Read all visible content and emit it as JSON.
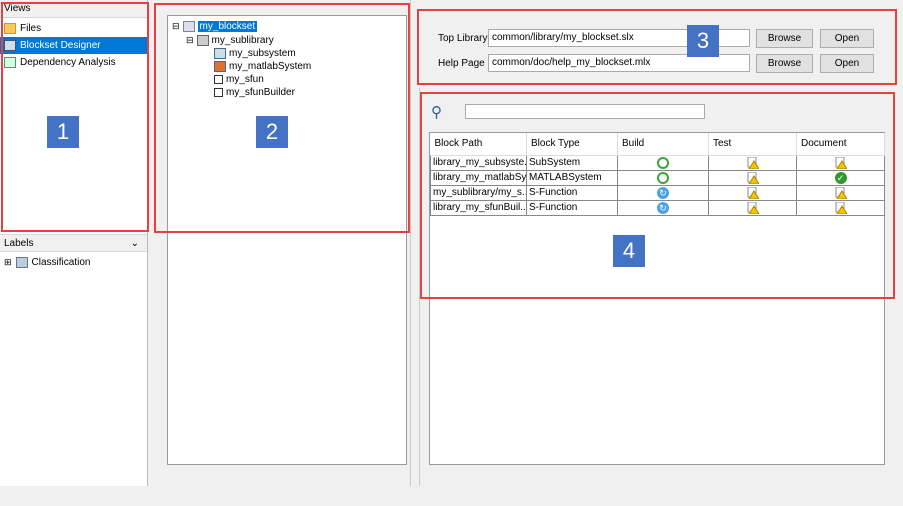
{
  "views": {
    "header": "Views",
    "items": [
      {
        "label": "Files",
        "icon": "folder-icon"
      },
      {
        "label": "Blockset Designer",
        "icon": "blockset-icon",
        "selected": true
      },
      {
        "label": "Dependency Analysis",
        "icon": "dependency-icon"
      }
    ]
  },
  "labels": {
    "header": "Labels",
    "items": [
      {
        "label": "Classification"
      }
    ]
  },
  "tree": {
    "root": "my_blockset",
    "sublibrary": "my_sublibrary",
    "children": [
      "my_subsystem",
      "my_matlabSystem",
      "my_sfun",
      "my_sfunBuilder"
    ]
  },
  "settings": {
    "top_library_label": "Top Library",
    "top_library_value": "common/library/my_blockset.slx",
    "help_page_label": "Help Page",
    "help_page_value": "common/doc/help_my_blockset.mlx",
    "browse_label": "Browse",
    "open_label": "Open"
  },
  "search": {
    "value": ""
  },
  "table": {
    "columns": [
      "Block Path",
      "Block Type",
      "Build",
      "Test",
      "Document"
    ],
    "rows": [
      {
        "path": "library_my_subsyste...",
        "type": "SubSystem",
        "build": "not-built",
        "test": "warning",
        "doc": "warning"
      },
      {
        "path": "library_my_matlabSy...",
        "type": "MATLABSystem",
        "build": "not-built",
        "test": "warning",
        "doc": "ok"
      },
      {
        "path": "my_sublibrary/my_s...",
        "type": "S-Function",
        "build": "refresh",
        "test": "warning",
        "doc": "warning"
      },
      {
        "path": "library_my_sfunBuil...",
        "type": "S-Function",
        "build": "refresh",
        "test": "warning",
        "doc": "warning"
      }
    ]
  },
  "badges": [
    "1",
    "2",
    "3",
    "4"
  ],
  "colors": {
    "accent": "#0078d7",
    "annotation": "#e84040",
    "badge": "#4472c4"
  }
}
